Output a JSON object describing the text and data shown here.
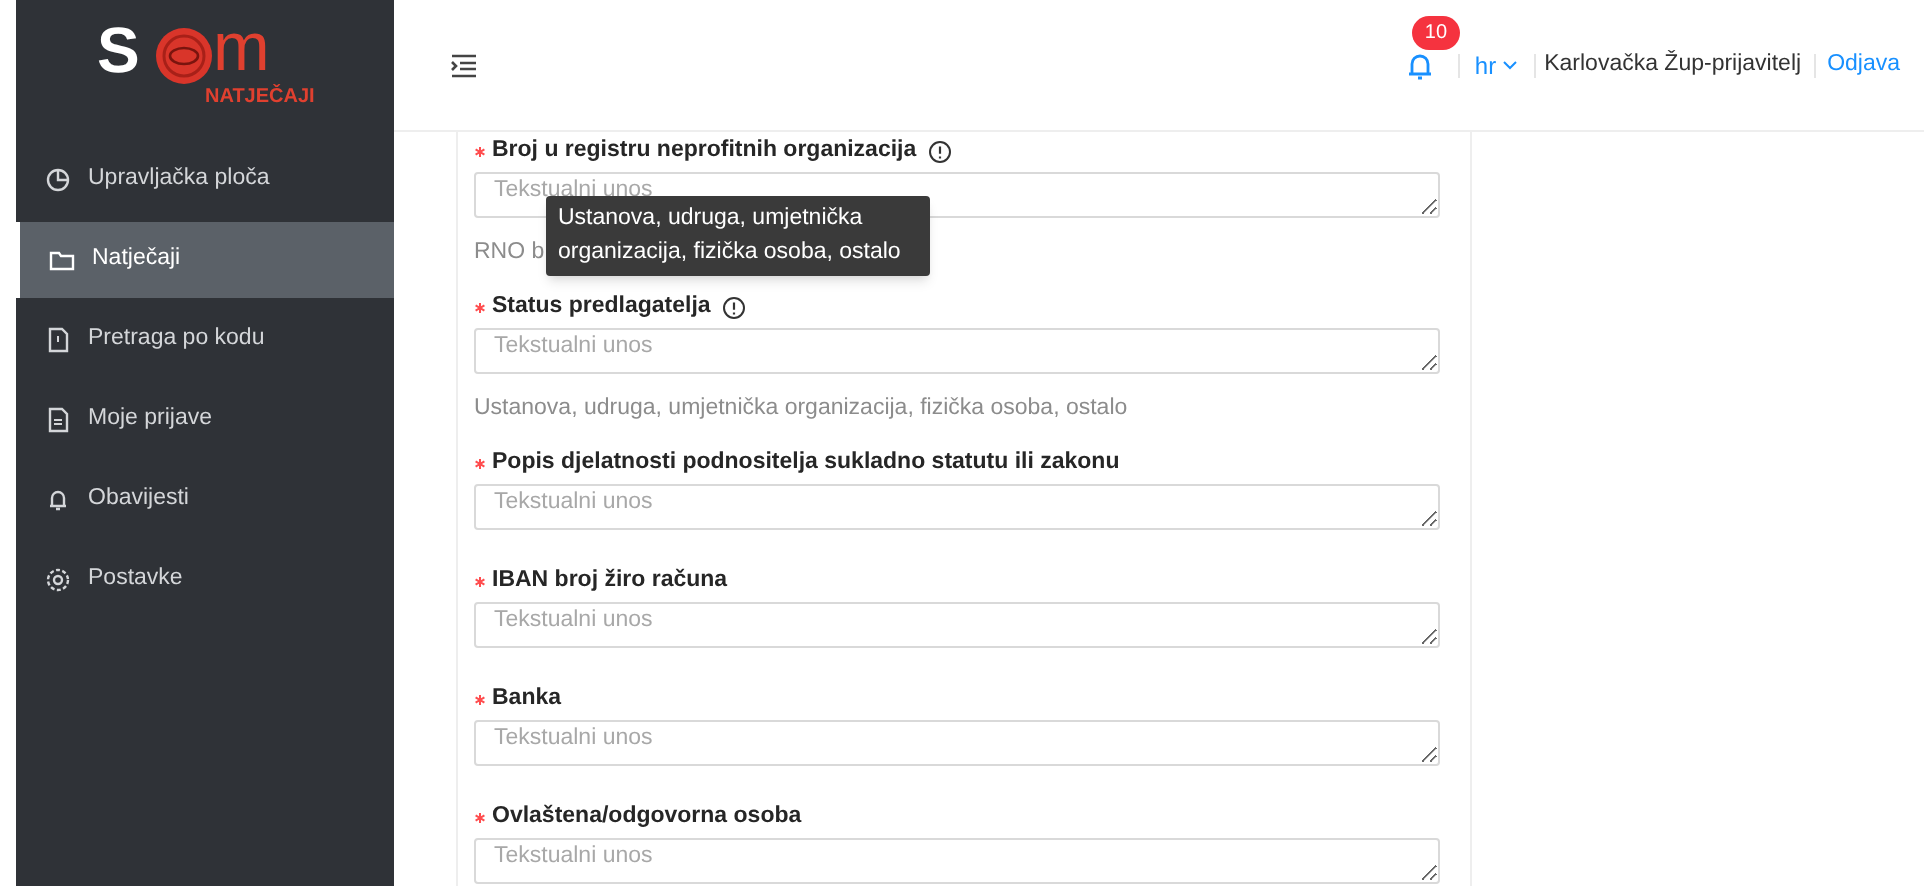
{
  "logo": {
    "parts": [
      "S",
      "m"
    ],
    "subtitle": "NATJEČAJI"
  },
  "sidebar": {
    "items": [
      {
        "label": "Upravljačka ploča",
        "selected": false
      },
      {
        "label": "Natječaji",
        "selected": true
      },
      {
        "label": "Pretraga po kodu",
        "selected": false
      },
      {
        "label": "Moje prijave",
        "selected": false
      },
      {
        "label": "Obavijesti",
        "selected": false
      },
      {
        "label": "Postavke",
        "selected": false
      }
    ]
  },
  "header": {
    "notifications": "10",
    "language": "hr",
    "user": "Karlovačka Žup-prijavitelj",
    "logout": "Odjava"
  },
  "form": {
    "fields": [
      {
        "label": "Broj u registru neprofitnih organizacija",
        "required": true,
        "info": true,
        "placeholder": "Tekstualni unos",
        "hint": "RNO b"
      },
      {
        "label": "Status predlagatelja",
        "required": true,
        "info": true,
        "placeholder": "Tekstualni unos",
        "hint": "Ustanova, udruga, umjetnička organizacija, fizička osoba, ostalo"
      },
      {
        "label": "Popis djelatnosti podnositelja sukladno statutu ili zakonu",
        "required": true,
        "info": false,
        "placeholder": "Tekstualni unos"
      },
      {
        "label": "IBAN broj žiro računa",
        "required": true,
        "info": false,
        "placeholder": "Tekstualni unos"
      },
      {
        "label": "Banka",
        "required": true,
        "info": false,
        "placeholder": "Tekstualni unos"
      },
      {
        "label": "Ovlaštena/odgovorna osoba",
        "required": true,
        "info": false,
        "placeholder": "Tekstualni unos"
      }
    ]
  },
  "tooltip": {
    "text": "Ustanova, udruga, umjetnička organizacija, fizička osoba, ostalo"
  }
}
